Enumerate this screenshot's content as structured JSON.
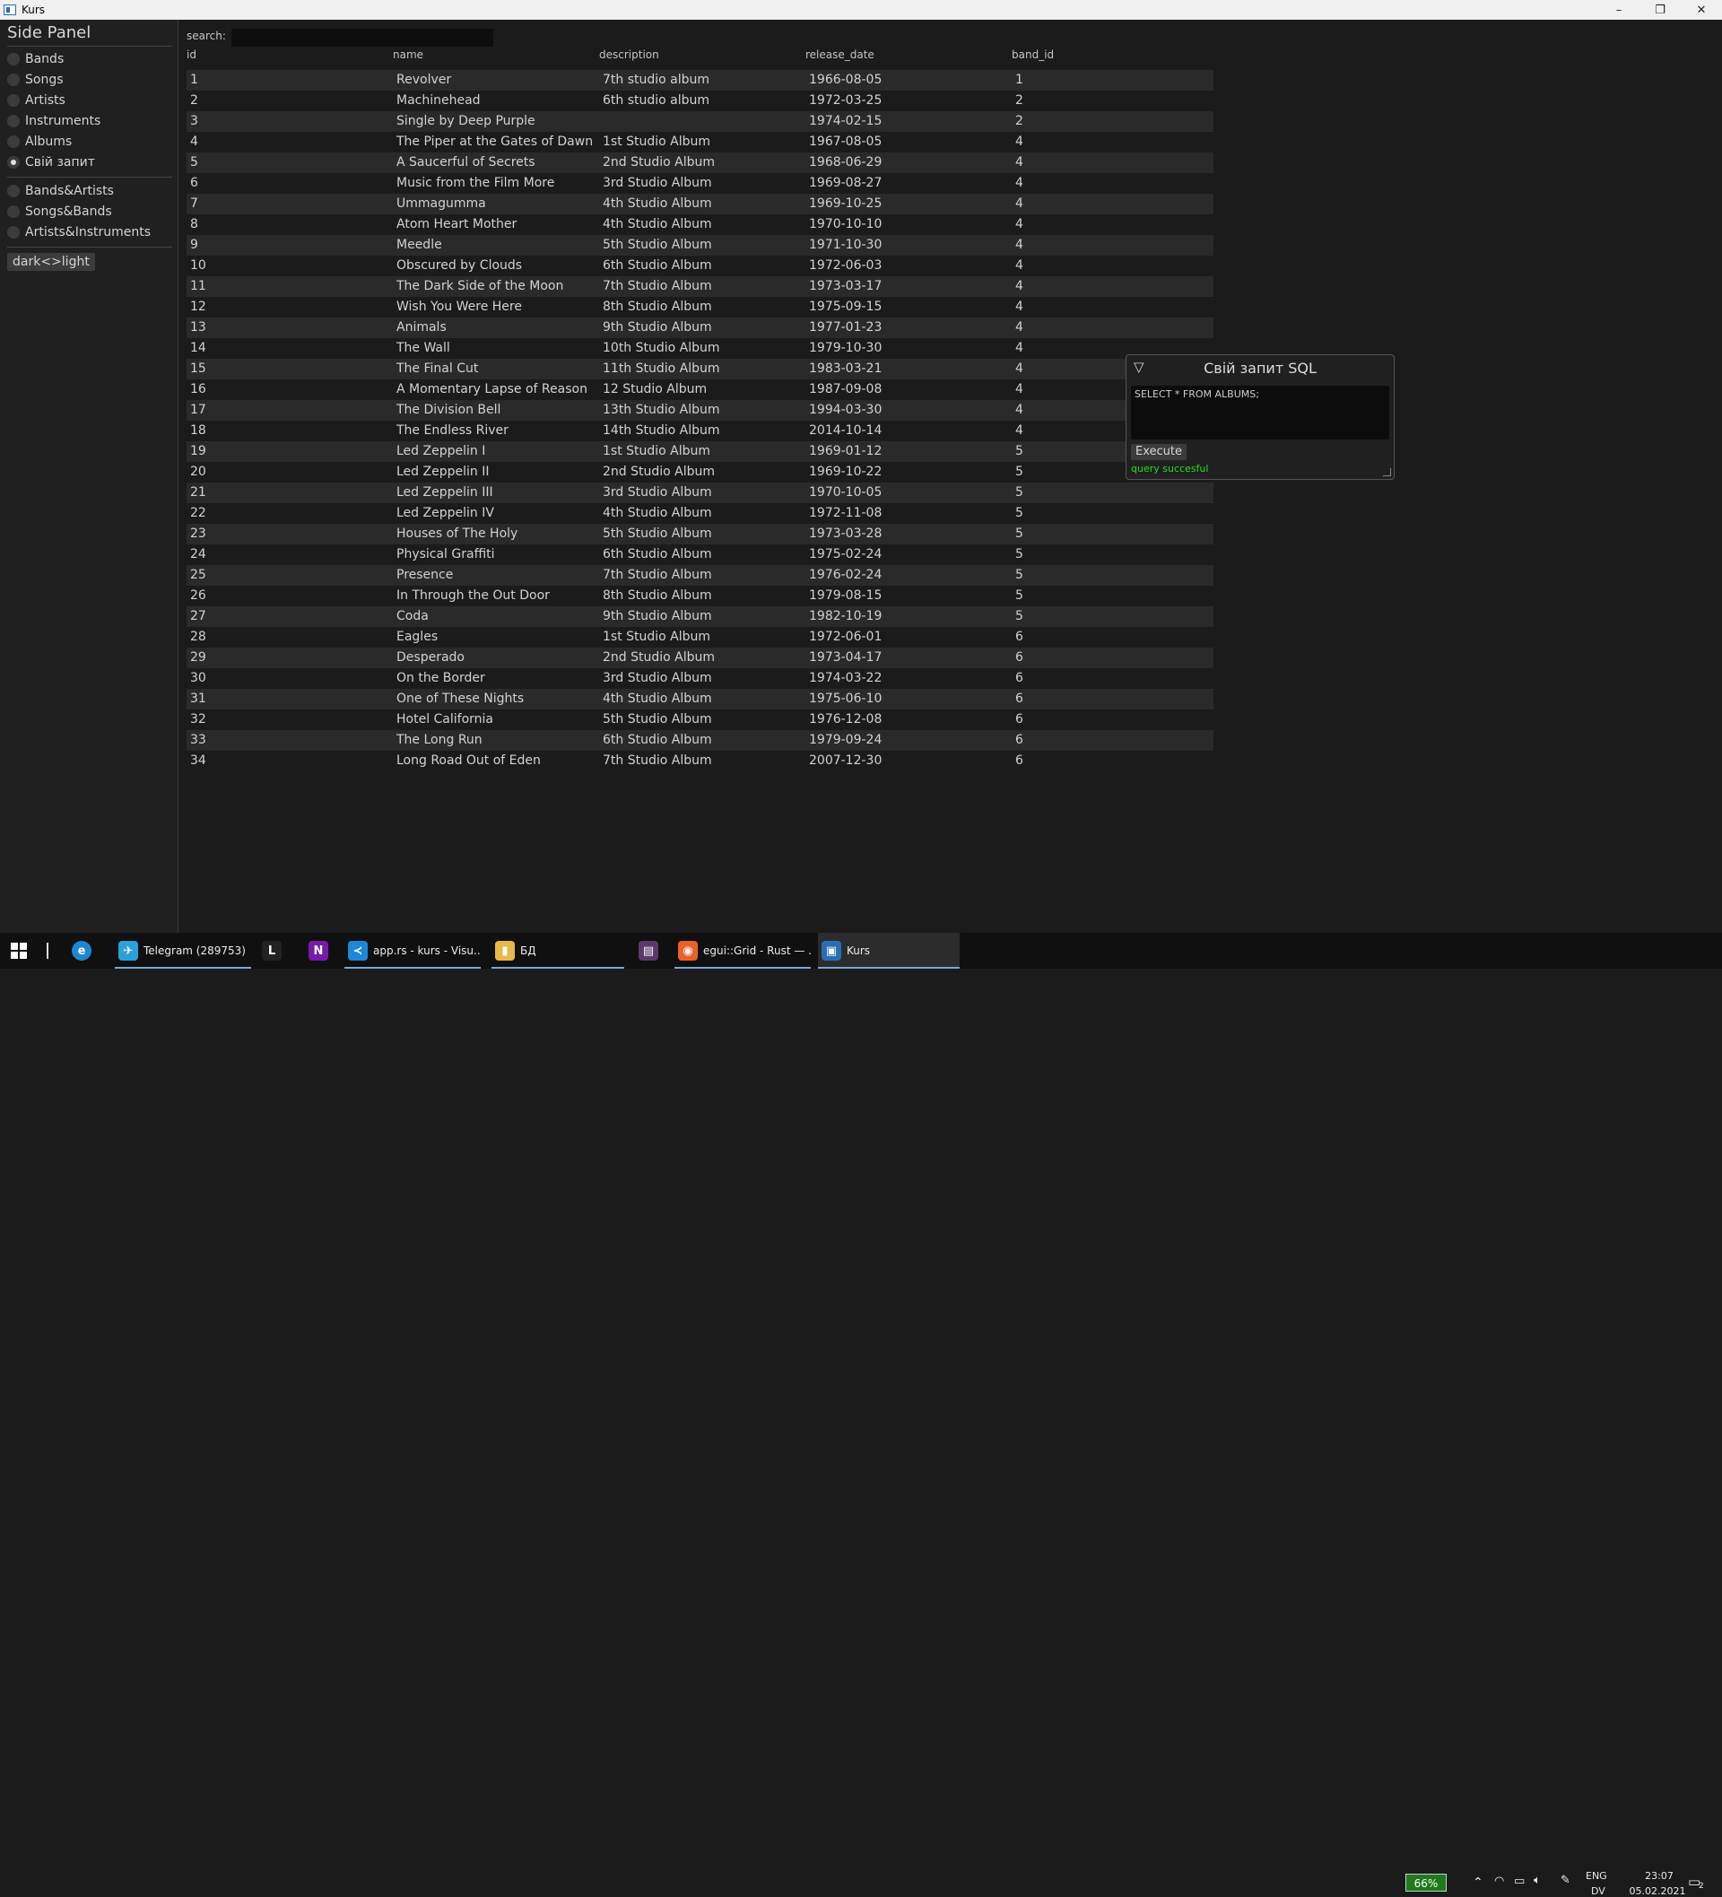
{
  "window": {
    "title": "Kurs",
    "controls": [
      "–",
      "❐",
      "✕"
    ]
  },
  "side_panel": {
    "title": "Side Panel",
    "group1": [
      {
        "label": "Bands",
        "selected": false
      },
      {
        "label": "Songs",
        "selected": false
      },
      {
        "label": "Artists",
        "selected": false
      },
      {
        "label": "Instruments",
        "selected": false
      },
      {
        "label": "Albums",
        "selected": false
      },
      {
        "label": "Свій запит",
        "selected": true
      }
    ],
    "group2": [
      {
        "label": "Bands&Artists",
        "selected": false
      },
      {
        "label": "Songs&Bands",
        "selected": false
      },
      {
        "label": "Artists&Instruments",
        "selected": false
      }
    ],
    "theme_toggle": "dark<>light"
  },
  "search": {
    "label": "search:",
    "value": ""
  },
  "table": {
    "columns": [
      "id",
      "name",
      "description",
      "release_date",
      "band_id"
    ],
    "rows": [
      [
        "1",
        "Revolver",
        "7th studio album",
        "1966-08-05",
        "1"
      ],
      [
        "2",
        "Machinehead",
        "6th studio album",
        "1972-03-25",
        "2"
      ],
      [
        "3",
        "Single by Deep Purple",
        "",
        "1974-02-15",
        "2"
      ],
      [
        "4",
        "The Piper at the Gates of Dawn",
        "1st Studio Album",
        "1967-08-05",
        "4"
      ],
      [
        "5",
        "A Saucerful of Secrets",
        "2nd Studio Album",
        "1968-06-29",
        "4"
      ],
      [
        "6",
        "Music from the Film More",
        "3rd Studio Album",
        "1969-08-27",
        "4"
      ],
      [
        "7",
        "Ummagumma",
        "4th Studio Album",
        "1969-10-25",
        "4"
      ],
      [
        "8",
        "Atom Heart Mother",
        "4th Studio Album",
        "1970-10-10",
        "4"
      ],
      [
        "9",
        "Meedle",
        "5th Studio Album",
        "1971-10-30",
        "4"
      ],
      [
        "10",
        "Obscured by Clouds",
        "6th Studio Album",
        "1972-06-03",
        "4"
      ],
      [
        "11",
        "The Dark Side of the Moon",
        "7th Studio Album",
        "1973-03-17",
        "4"
      ],
      [
        "12",
        "Wish You Were Here",
        "8th Studio Album",
        "1975-09-15",
        "4"
      ],
      [
        "13",
        "Animals",
        "9th Studio Album",
        "1977-01-23",
        "4"
      ],
      [
        "14",
        "The Wall",
        "10th Studio Album",
        "1979-10-30",
        "4"
      ],
      [
        "15",
        "The Final Cut",
        "11th Studio Album",
        "1983-03-21",
        "4"
      ],
      [
        "16",
        "A Momentary Lapse of Reason",
        "12 Studio Album",
        "1987-09-08",
        "4"
      ],
      [
        "17",
        "The Division Bell",
        "13th Studio Album",
        "1994-03-30",
        "4"
      ],
      [
        "18",
        "The Endless River",
        "14th Studio Album",
        "2014-10-14",
        "4"
      ],
      [
        "19",
        "Led Zeppelin I",
        "1st Studio Album",
        "1969-01-12",
        "5"
      ],
      [
        "20",
        "Led Zeppelin II",
        "2nd Studio Album",
        "1969-10-22",
        "5"
      ],
      [
        "21",
        "Led Zeppelin III",
        "3rd Studio Album",
        "1970-10-05",
        "5"
      ],
      [
        "22",
        "Led Zeppelin IV",
        "4th Studio Album",
        "1972-11-08",
        "5"
      ],
      [
        "23",
        "Houses of The Holy",
        "5th Studio Album",
        "1973-03-28",
        "5"
      ],
      [
        "24",
        "Physical Graffiti",
        "6th Studio Album",
        "1975-02-24",
        "5"
      ],
      [
        "25",
        "Presence",
        "7th Studio Album",
        "1976-02-24",
        "5"
      ],
      [
        "26",
        "In Through the Out Door",
        "8th Studio Album",
        "1979-08-15",
        "5"
      ],
      [
        "27",
        "Coda",
        "9th Studio Album",
        "1982-10-19",
        "5"
      ],
      [
        "28",
        "Eagles",
        "1st Studio Album",
        "1972-06-01",
        "6"
      ],
      [
        "29",
        "Desperado",
        "2nd Studio Album",
        "1973-04-17",
        "6"
      ],
      [
        "30",
        "On the Border",
        "3rd Studio Album",
        "1974-03-22",
        "6"
      ],
      [
        "31",
        "One of These Nights",
        "4th Studio Album",
        "1975-06-10",
        "6"
      ],
      [
        "32",
        "Hotel California",
        "5th Studio Album",
        "1976-12-08",
        "6"
      ],
      [
        "33",
        "The Long Run",
        "6th Studio Album",
        "1979-09-24",
        "6"
      ],
      [
        "34",
        "Long Road Out of Eden",
        "7th Studio Album",
        "2007-12-30",
        "6"
      ]
    ]
  },
  "sql_window": {
    "collapse_glyph": "▽",
    "title": "Свій запит SQL",
    "query": "SELECT * FROM ALBUMS;",
    "execute_label": "Execute",
    "status": "query succesful",
    "status_color": "#22dd22"
  },
  "taskbar": {
    "items": [
      {
        "label": "Telegram (289753)",
        "icon": "telegram-icon",
        "glyph": "✈",
        "color": "#2aa1da",
        "running": true,
        "active": false
      },
      {
        "label": "",
        "icon": "l-app-icon",
        "glyph": "L",
        "color": "#222222",
        "running": false,
        "active": false
      },
      {
        "label": "",
        "icon": "onenote-icon",
        "glyph": "N",
        "color": "#7719aa",
        "running": false,
        "active": false
      },
      {
        "label": "app.rs - kurs - Visu...",
        "icon": "vscode-icon",
        "glyph": "≺",
        "color": "#1e88d8",
        "running": true,
        "active": false
      },
      {
        "label": "БД",
        "icon": "folder-icon",
        "glyph": "▮",
        "color": "#e8b84a",
        "running": true,
        "active": false
      },
      {
        "label": "",
        "icon": "app-icon",
        "glyph": "▤",
        "color": "#5a3a6a",
        "running": false,
        "active": false
      },
      {
        "label": "egui::Grid - Rust — ...",
        "icon": "firefox-icon",
        "glyph": "◉",
        "color": "#e8622a",
        "running": true,
        "active": false
      },
      {
        "label": "Kurs",
        "icon": "kurs-window-icon",
        "glyph": "▣",
        "color": "#2a6db5",
        "running": true,
        "active": true
      }
    ],
    "battery_badge": "66%",
    "lang_top": "ENG",
    "lang_bottom": "DV",
    "time": "23:07",
    "date": "05.02.2021",
    "notification_count": "2"
  }
}
